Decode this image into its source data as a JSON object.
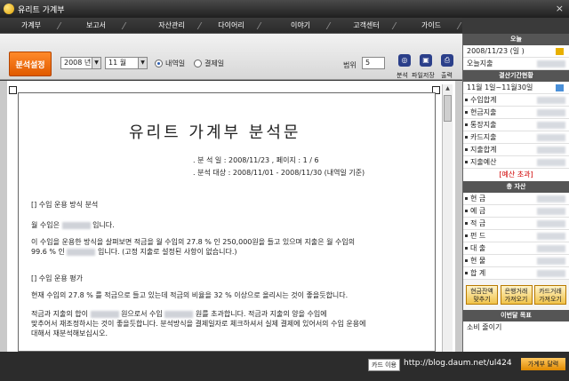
{
  "window": {
    "title": "유리트 가계부",
    "close": "×"
  },
  "menu": [
    "가계부",
    "보고서",
    "자산관리",
    "다이어리",
    "이야기",
    "고객센터",
    "가이드"
  ],
  "toolbar": {
    "analysis_setting": "분석설정",
    "year": "2008 년",
    "month": "11 월",
    "radio_income": "내역일",
    "radio_settle": "결제일",
    "range_label": "범위",
    "range_value": "5",
    "analysis_label": "분석",
    "save_label": "파일저장",
    "print_label": "출력"
  },
  "document": {
    "title": "유리트 가계부 분석문",
    "analysis_date": ". 분 석 일 : 2008/11/23     , 페이지 :    1 / 6",
    "analysis_target": ". 분석 대상 : 2008/11/01 - 2008/11/30 (내역일 기준)",
    "sec1": "[] 수입 운용 방식 분석",
    "line_month_income": "월 수입은",
    "line_month_income_end": "입니다.",
    "line_analysis": "이 수입을 운용한 방식을 살펴보면 적금을 월 수입의 27.8 % 인 250,000원을 들고 있으며 지출은 월 수입의",
    "line_analysis2a": "99.6 % 인",
    "line_analysis2b": "입니다. (고정 지출로 설정된 사항이 없습니다.)",
    "sec2": "[] 수입 운용 평가",
    "line_eval": "현재 수입의 27.8 % 를 적금으로 들고 있는데 적금의 비율을 32 % 이상으로 올리시는 것이 좋을듯합니다.",
    "line_eval2a": "적금과 지출의 합이",
    "line_eval2b": "원으로서 수입",
    "line_eval2c": "원를 초과합니다. 적금과 지출의 양을 수입에",
    "line_eval3": "맞추어서 재조정하시는 것이 좋을듯합니다. 분석방식을 결제일자로 체크하셔서 실제 결제에 있어서의 수입 운용에",
    "line_eval4": "대해서 재분석해보십시오."
  },
  "sidebar": {
    "today_head": "오늘",
    "today_date": "2008/11/23 (일 )",
    "today_spend": "오늘지출",
    "period_head": "결산기간현황",
    "period_range": "11월 1일~11월30일",
    "period_rows": [
      "수입합계",
      "현금지출",
      "통장지출",
      "카드지출",
      "지출합계",
      "지출예산"
    ],
    "budget_over": "[예산 초과]",
    "asset_head": "총 자산",
    "asset_rows": [
      "현 금",
      "예 금",
      "적 금",
      "펀 드",
      "대 출",
      "현 물",
      "합 계"
    ],
    "btn1": "현금잔액 맞추기",
    "btn2": "은행거래 가져오기",
    "btn3": "카드거래 가져오기",
    "goal_head": "이번달 목표",
    "goal_text": "소비 줄이기"
  },
  "status": {
    "card_import": "카드 이용",
    "url": "http://blog.daum.net/ul424",
    "side_button": "가계부 달력"
  },
  "colors": {
    "accent_orange": "#e86a10",
    "header_dark": "#555555",
    "over_budget": "#d00000"
  }
}
